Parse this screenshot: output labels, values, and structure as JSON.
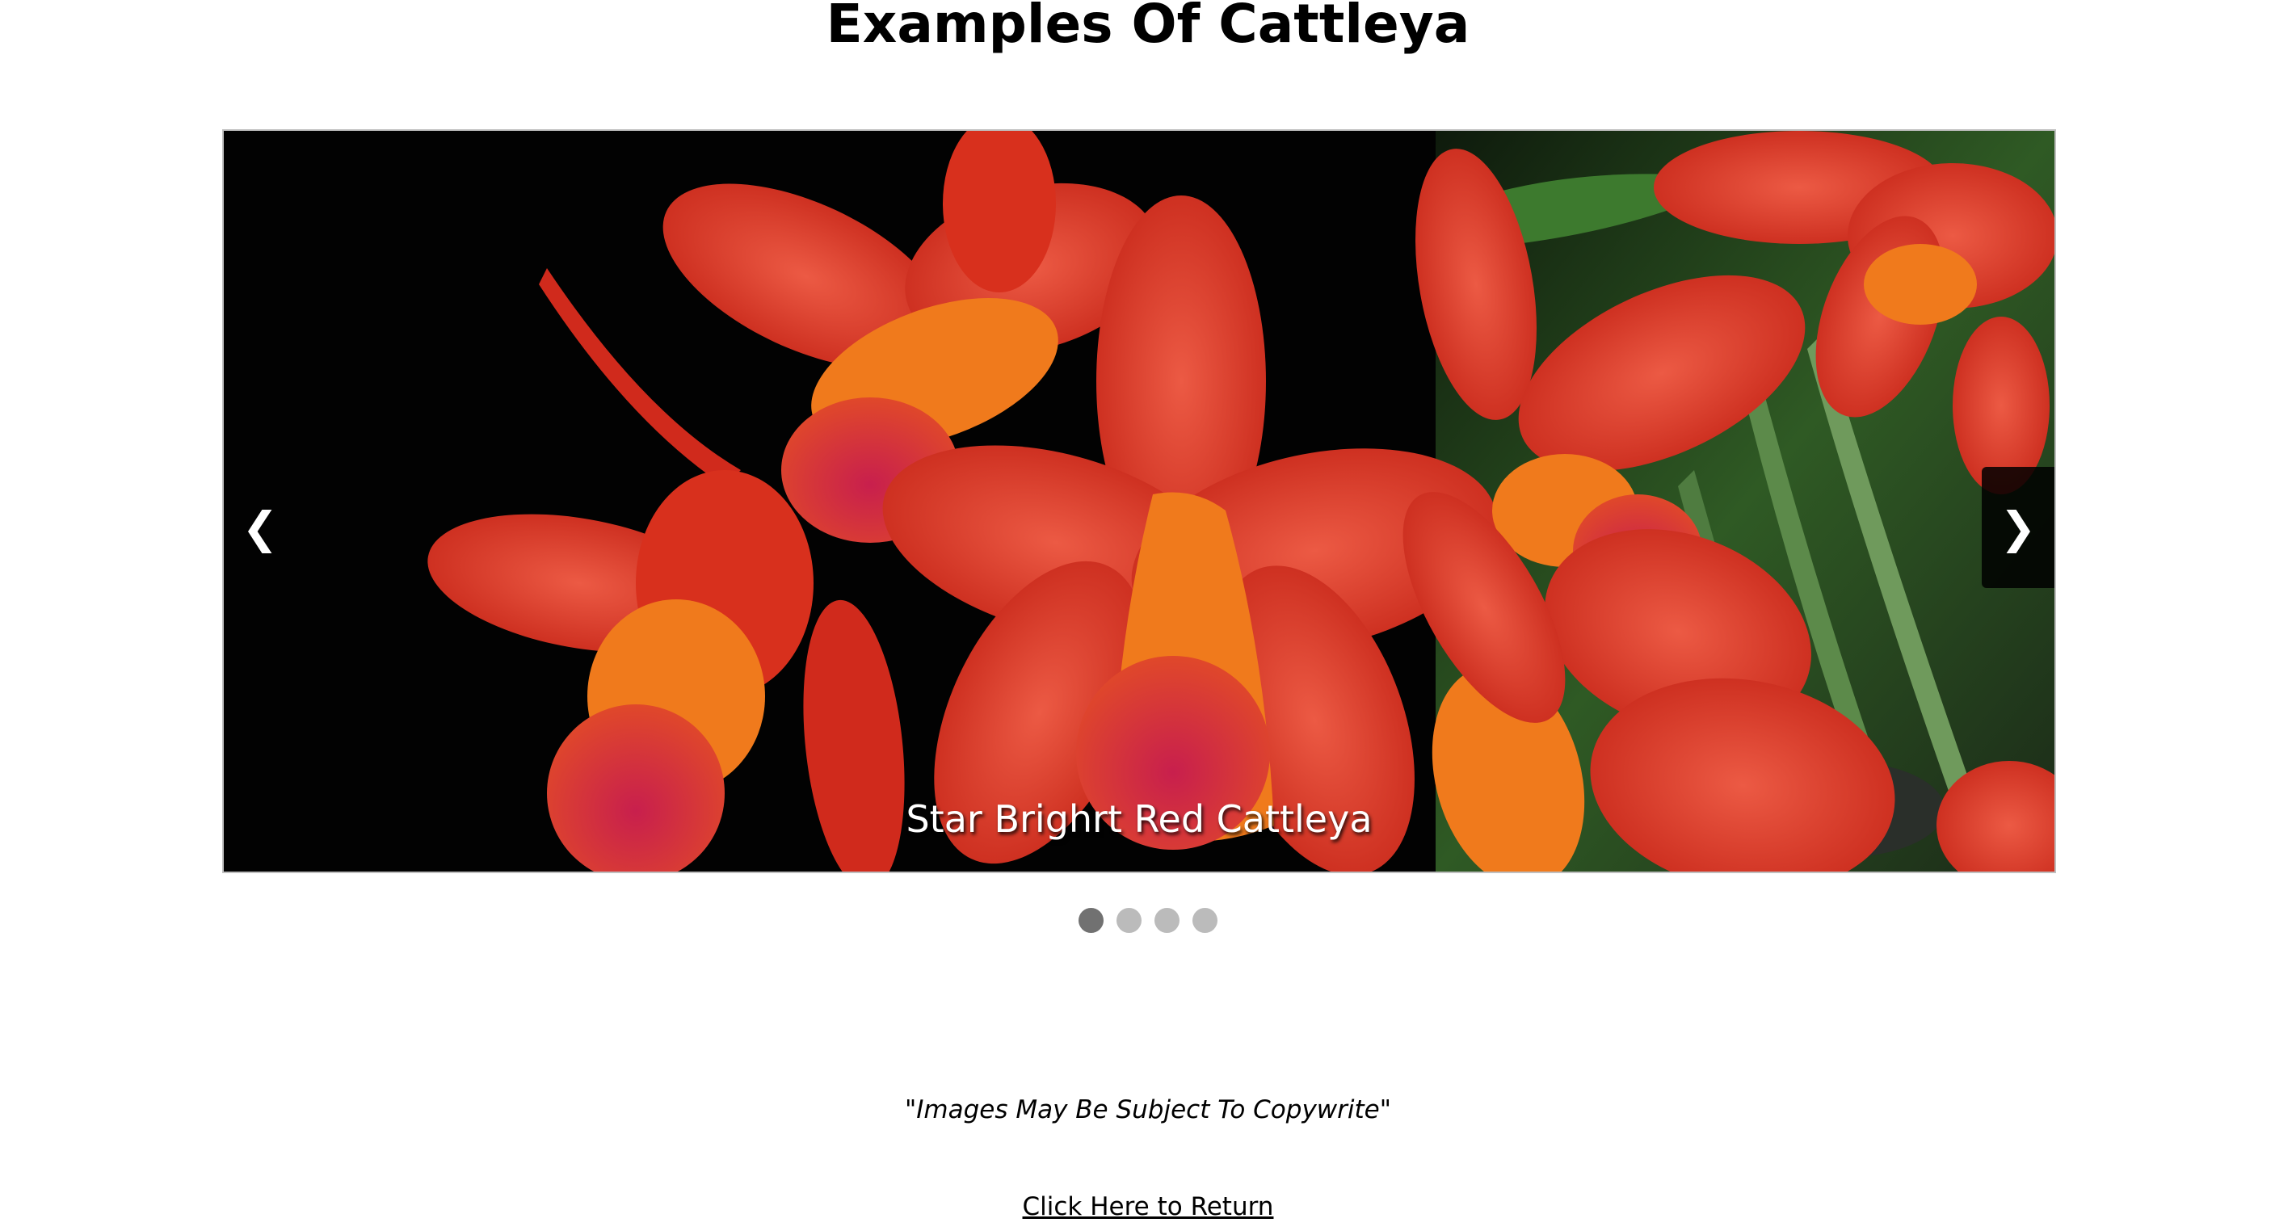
{
  "page": {
    "title": "Examples Of Cattleya"
  },
  "slideshow": {
    "caption": "Star Brighrt Red Cattleya",
    "prev_symbol": "❮",
    "next_symbol": "❯",
    "slide_count": 4,
    "active_slide": 1
  },
  "footer": {
    "notice": "\"Images May Be Subject To Copywrite\"",
    "return_link": "Click Here to Return"
  },
  "colors": {
    "dot_active": "#717171",
    "dot_inactive": "#bbbbbb",
    "petal": "#d9321f",
    "lip": "#b01e3a",
    "orange": "#f07a1c"
  }
}
